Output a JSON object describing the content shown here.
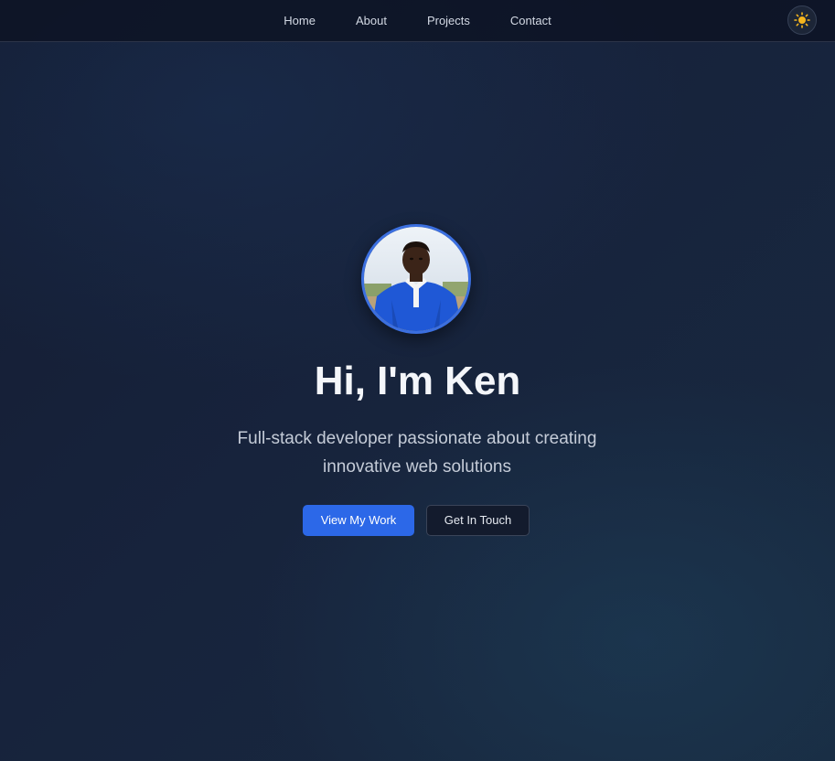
{
  "nav": {
    "links": [
      {
        "label": "Home"
      },
      {
        "label": "About"
      },
      {
        "label": "Projects"
      },
      {
        "label": "Contact"
      }
    ],
    "theme_toggle_icon": "sun-icon"
  },
  "hero": {
    "avatar_icon": "profile-photo",
    "title": "Hi, I'm Ken",
    "subtitle": "Full-stack developer passionate about creating innovative web solutions",
    "primary_button": "View My Work",
    "secondary_button": "Get In Touch"
  },
  "colors": {
    "accent": "#2c68e8",
    "background": "#141d33",
    "text": "#f4f6fa"
  }
}
